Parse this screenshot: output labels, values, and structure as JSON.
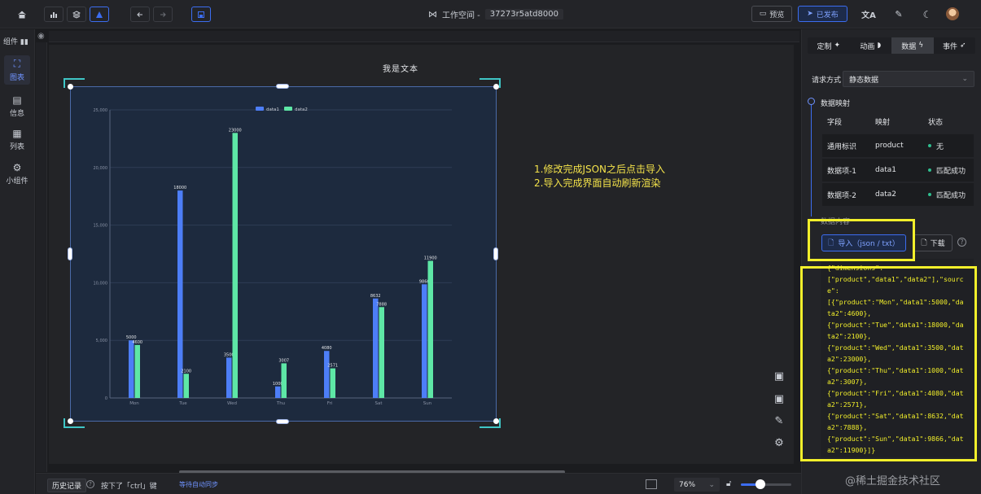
{
  "topbar": {
    "workspace_label": "工作空间 -",
    "workspace_id": "37273r5atd8000",
    "preview_label": "预览",
    "publish_label": "已发布"
  },
  "leftbar": {
    "title": "组件",
    "items": [
      {
        "label": "图表",
        "icon": "chart-icon",
        "active": true
      },
      {
        "label": "信息",
        "icon": "info-icon",
        "active": false
      },
      {
        "label": "列表",
        "icon": "table-icon",
        "active": false
      },
      {
        "label": "小组件",
        "icon": "widget-icon",
        "active": false
      }
    ]
  },
  "canvas": {
    "chart_title": "我是文本",
    "instructions": [
      "1.修改完成JSON之后点击导入",
      "2.导入完成界面自动刷新渲染"
    ]
  },
  "chart_data": {
    "type": "bar",
    "categories": [
      "Mon",
      "Tue",
      "Wed",
      "Thu",
      "Fri",
      "Sat",
      "Sun"
    ],
    "series": [
      {
        "name": "data1",
        "values": [
          5000,
          18000,
          3500,
          1000,
          4080,
          8632,
          9866
        ],
        "color": "#4d7ef7"
      },
      {
        "name": "data2",
        "values": [
          4600,
          2100,
          23000,
          3007,
          2571,
          7888,
          11900
        ],
        "color": "#5ee7a6"
      }
    ],
    "data_labels": [
      [
        "5000",
        "18000",
        "3500",
        "1000",
        "4080",
        "8632",
        "9866"
      ],
      [
        "4600",
        "2100",
        "23000",
        "3007",
        "2571",
        "7888",
        "11900"
      ]
    ],
    "yticks": [
      "0",
      "5,000",
      "10,000",
      "15,000",
      "20,000",
      "25,000"
    ],
    "ylim": [
      0,
      25000
    ],
    "legend_position": "top",
    "grid": true
  },
  "bottombar": {
    "history_label": "历史记录",
    "hint_text": "按下了「ctrl」键",
    "autosave_text": "等待自动同步",
    "zoom_value": "76%",
    "zoom_level": 0.38
  },
  "rightpanel": {
    "tabs": [
      {
        "label": "定制",
        "icon": "wrench-icon",
        "active": false
      },
      {
        "label": "动画",
        "icon": "animation-icon",
        "active": false
      },
      {
        "label": "数据",
        "icon": "bolt-icon",
        "active": true
      },
      {
        "label": "事件",
        "icon": "rocket-icon",
        "active": false
      }
    ],
    "request_label": "请求方式",
    "request_value": "静态数据",
    "mapping_title": "数据映射",
    "mapping_headers": [
      "字段",
      "映射",
      "状态"
    ],
    "mapping_rows": [
      {
        "field": "通用标识",
        "map": "product",
        "status": "无"
      },
      {
        "field": "数据项-1",
        "map": "data1",
        "status": "匹配成功"
      },
      {
        "field": "数据项-2",
        "map": "data2",
        "status": "匹配成功"
      }
    ],
    "content_title": "数据内容",
    "import_label": "导入（json / txt）",
    "download_label": "下载",
    "code_text": "{\"dimensions\":\n[\"product\",\"data1\",\"data2\"],\"sourc\ne\":\n[{\"product\":\"Mon\",\"data1\":5000,\"da\nta2\":4600},\n{\"product\":\"Tue\",\"data1\":18000,\"da\nta2\":2100},\n{\"product\":\"Wed\",\"data1\":3500,\"dat\na2\":23000},\n{\"product\":\"Thu\",\"data1\":1000,\"dat\na2\":3007},\n{\"product\":\"Fri\",\"data1\":4080,\"dat\na2\":2571},\n{\"product\":\"Sat\",\"data1\":8632,\"dat\na2\":7888},\n{\"product\":\"Sun\",\"data1\":9866,\"dat\na2\":11900}]}"
  },
  "watermark": "@稀土掘金技术社区",
  "colors": {
    "accent": "#3c6df0",
    "highlight": "#f2ef2b",
    "instruction": "#f3e24a"
  }
}
